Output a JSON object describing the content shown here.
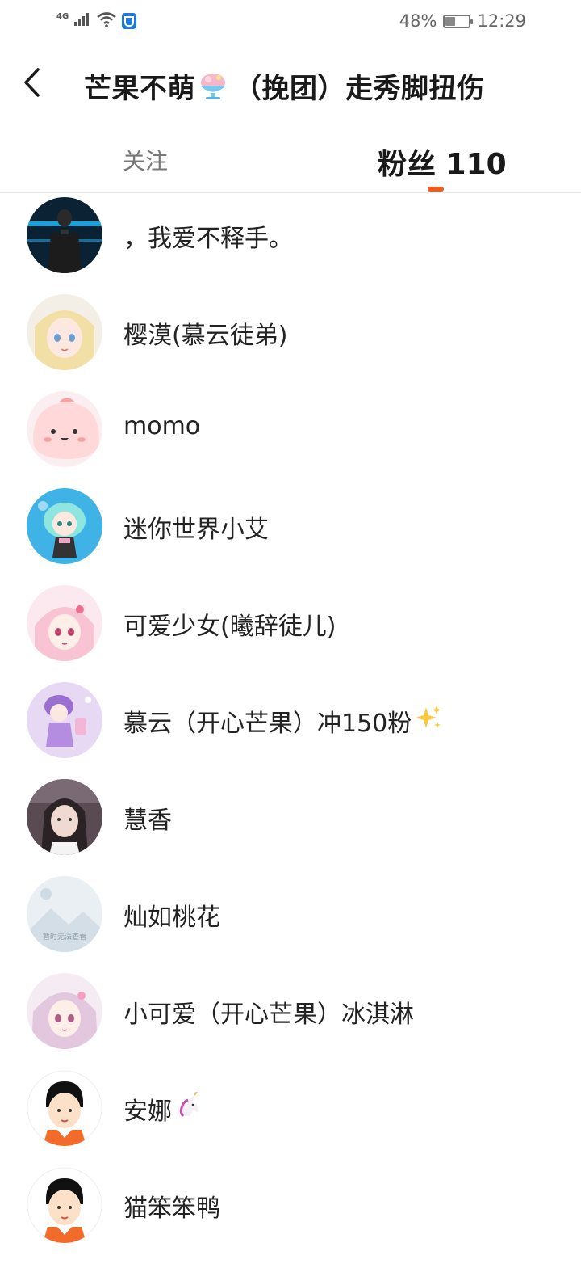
{
  "status_bar": {
    "network": "4G",
    "battery": "48%",
    "battery_level": 0.48,
    "time": "12:29",
    "icons": [
      "signal-icon",
      "wifi-icon",
      "shield-icon",
      "battery-icon"
    ]
  },
  "header": {
    "back_icon": "chevron-left-icon",
    "title_part1": "芒果不萌",
    "title_emoji": "shaved-ice-icon",
    "title_part2": "（挽团）走秀脚扭伤"
  },
  "tabs": {
    "follow_label": "关注",
    "fans_label": "粉丝 110",
    "active": "fans",
    "accent_color": "#f05a1a"
  },
  "fans": [
    {
      "name": "，我爱不释手。",
      "avatar": "avatar-dark-hero"
    },
    {
      "name": "樱漠(慕云徒弟)",
      "avatar": "avatar-anime-blonde"
    },
    {
      "name": "momo",
      "avatar": "avatar-pink-blob"
    },
    {
      "name": "迷你世界小艾",
      "avatar": "avatar-teal-chibi"
    },
    {
      "name": "可爱少女(曦辞徒儿)",
      "avatar": "avatar-pink-anime"
    },
    {
      "name": "慕云（开心芒果）冲150粉",
      "avatar": "avatar-purple-chibi",
      "emoji": "sparkles-icon"
    },
    {
      "name": "慧香",
      "avatar": "avatar-photo-girl"
    },
    {
      "name": "灿如桃花",
      "avatar": "avatar-placeholder",
      "avatar_text": "暂时无法查看"
    },
    {
      "name": "小可爱（开心芒果）冰淇淋",
      "avatar": "avatar-anime-lilac"
    },
    {
      "name": "安娜",
      "avatar": "avatar-default-cartoon",
      "emoji": "unicorn-icon"
    },
    {
      "name": "猫笨笨鸭",
      "avatar": "avatar-default-cartoon"
    }
  ]
}
